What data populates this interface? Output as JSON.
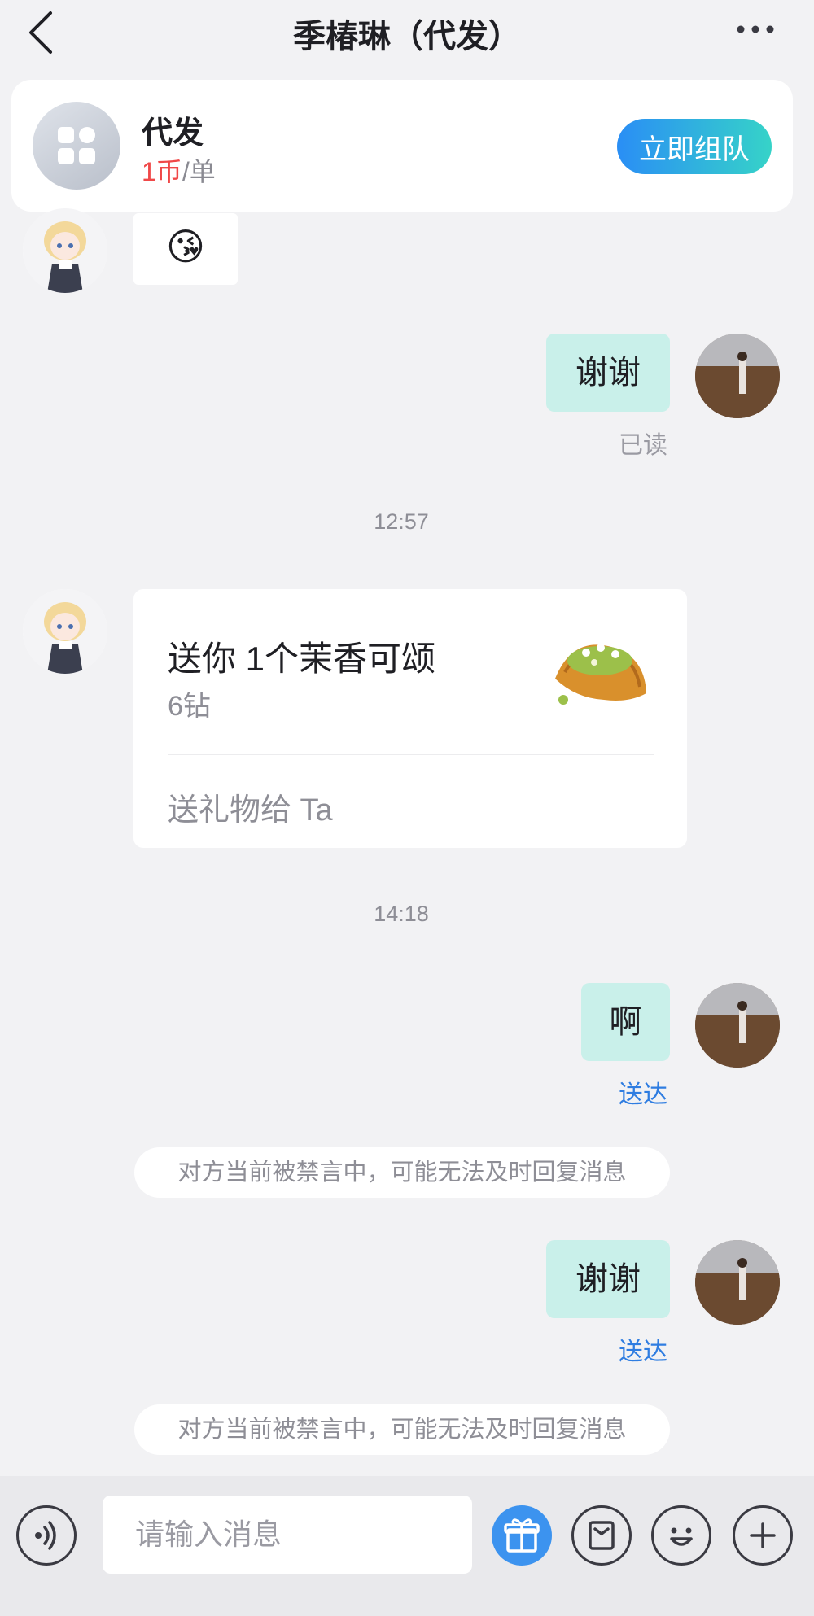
{
  "header": {
    "title": "季椿琳（代发）"
  },
  "service_card": {
    "name": "代发",
    "price_amount": "1币",
    "price_unit": "/单",
    "team_button": "立即组队"
  },
  "messages": {
    "m1_emoji": "😘",
    "m2_text": "谢谢",
    "m2_status": "已读",
    "time1": "12:57",
    "gift": {
      "title": "送你 1个茉香可颂",
      "price": "6钻",
      "send_label": "送礼物给 Ta"
    },
    "time2": "14:18",
    "m3_text": "啊",
    "m3_status": "送达",
    "notice1": "对方当前被禁言中，可能无法及时回复消息",
    "m4_text": "谢谢",
    "m4_status": "送达",
    "notice2": "对方当前被禁言中，可能无法及时回复消息"
  },
  "input_bar": {
    "placeholder": "请输入消息"
  },
  "colors": {
    "accent_blue": "#2f7de1",
    "price_red": "#f04848",
    "bubble_out": "#c9f0ea",
    "gift_button": "#3c93ef"
  },
  "icons": [
    "back-icon",
    "more-icon",
    "grid-icon",
    "voice-icon",
    "gift-icon",
    "card-icon",
    "emoji-icon",
    "plus-icon"
  ]
}
